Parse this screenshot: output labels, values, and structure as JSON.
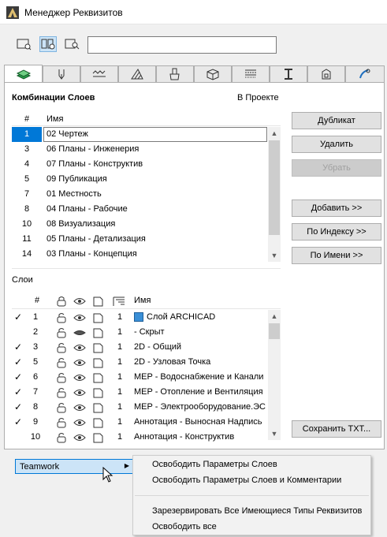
{
  "window": {
    "title": "Менеджер Реквизитов"
  },
  "toolbar": {
    "buttons": [
      "list-view-icon",
      "split-view-icon",
      "preview-view-icon"
    ],
    "search": {
      "value": "",
      "placeholder": ""
    }
  },
  "tabs": [
    {
      "icon": "layers-icon",
      "active": true
    },
    {
      "icon": "pen-icon"
    },
    {
      "icon": "line-types-icon"
    },
    {
      "icon": "fill-icon"
    },
    {
      "icon": "surface-paint-icon"
    },
    {
      "icon": "building-material-icon"
    },
    {
      "icon": "composite-icon"
    },
    {
      "icon": "profile-icon"
    },
    {
      "icon": "zone-category-icon"
    },
    {
      "icon": "mep-icon"
    }
  ],
  "combinations": {
    "heading": "Комбинации Слоев",
    "in_project_label": "В Проекте",
    "col_num": "#",
    "col_name": "Имя",
    "rows": [
      {
        "num": "1",
        "name": "02 Чертеж",
        "selected": true
      },
      {
        "num": "3",
        "name": "06 Планы - Инженерия"
      },
      {
        "num": "4",
        "name": "07 Планы - Конструктив"
      },
      {
        "num": "5",
        "name": "09 Публикация"
      },
      {
        "num": "7",
        "name": "01 Местность"
      },
      {
        "num": "8",
        "name": "04 Планы - Рабочие"
      },
      {
        "num": "10",
        "name": "08 Визуализация"
      },
      {
        "num": "11",
        "name": "05 Планы - Детализация"
      },
      {
        "num": "14",
        "name": "03 Планы - Концепция"
      }
    ]
  },
  "buttons": {
    "duplicate": "Дубликат",
    "delete": "Удалить",
    "remove": "Убрать",
    "add": "Добавить >>",
    "by_index": "По Индексу >>",
    "by_name": "По Имени >>",
    "save_txt": "Сохранить ТХТ..."
  },
  "layers": {
    "heading": "Слои",
    "col_num": "#",
    "col_name": "Имя",
    "rows": [
      {
        "check": "✓",
        "num": "1",
        "cnt": "1",
        "name": "Слой ARCHICAD",
        "hidden": false,
        "special": true
      },
      {
        "check": "",
        "num": "2",
        "cnt": "1",
        "name": "- Скрыт",
        "hidden": true
      },
      {
        "check": "✓",
        "num": "3",
        "cnt": "1",
        "name": "2D - Общий"
      },
      {
        "check": "✓",
        "num": "5",
        "cnt": "1",
        "name": "2D - Узловая Точка"
      },
      {
        "check": "✓",
        "num": "6",
        "cnt": "1",
        "name": "MEP - Водоснабжение и Канали"
      },
      {
        "check": "✓",
        "num": "7",
        "cnt": "1",
        "name": "MEP - Отопление и Вентиляция"
      },
      {
        "check": "✓",
        "num": "8",
        "cnt": "1",
        "name": "MEP - Электрооборудование.ЭС"
      },
      {
        "check": "✓",
        "num": "9",
        "cnt": "1",
        "name": "Аннотация - Выносная Надпись"
      },
      {
        "check": "",
        "num": "10",
        "cnt": "1",
        "name": "Аннотация - Конструктив"
      }
    ]
  },
  "teamwork": {
    "label": "Teamwork"
  },
  "menu": {
    "items": [
      "Освободить Параметры Слоев",
      "Освободить Параметры Слоев и Комментарии",
      "Зарезервировать Все Имеющиеся Типы Реквизитов",
      "Освободить все"
    ]
  },
  "colors": {
    "accent": "#0078d7",
    "selected_bg": "#cce4f7"
  }
}
